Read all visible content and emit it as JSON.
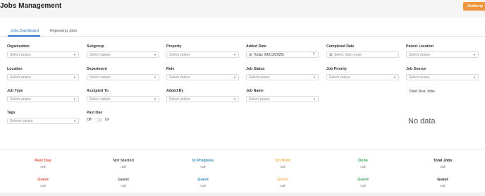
{
  "app": {
    "title": "Jobs Management",
    "user": "Anthony"
  },
  "tabs": [
    {
      "label": "Jobs Dashboard",
      "active": true
    },
    {
      "label": "Repeating Jobs",
      "active": false
    }
  ],
  "filters": {
    "organization": {
      "label": "Organization",
      "placeholder": "Select values"
    },
    "subgroup": {
      "label": "Subgroup",
      "placeholder": "Select values"
    },
    "property": {
      "label": "Property",
      "placeholder": "Select values"
    },
    "added_date": {
      "label": "Added Date",
      "value": "Today (06/13/2025)"
    },
    "completed_date": {
      "label": "Completed Date",
      "placeholder": "Select date range"
    },
    "parent_location": {
      "label": "Parent Location",
      "placeholder": "Select values"
    },
    "location": {
      "label": "Location",
      "placeholder": "Select values"
    },
    "department": {
      "label": "Department",
      "placeholder": "Select values"
    },
    "role": {
      "label": "Role",
      "placeholder": "Select values"
    },
    "job_status": {
      "label": "Job Status",
      "placeholder": "Select values"
    },
    "job_priority": {
      "label": "Job Priority",
      "placeholder": "Select values"
    },
    "job_source": {
      "label": "Job Source",
      "placeholder": "Select values"
    },
    "job_type": {
      "label": "Job Type",
      "placeholder": "Select values"
    },
    "assigned_to": {
      "label": "Assigned To",
      "placeholder": "Select values"
    },
    "added_by": {
      "label": "Added By",
      "placeholder": "Select values"
    },
    "job_name": {
      "label": "Job Name",
      "placeholder": "Select values"
    },
    "tags": {
      "label": "Tags",
      "placeholder": "Selecte values"
    },
    "past_due": {
      "label": "Past Due",
      "off": "Off",
      "on": "On",
      "enabled": false
    }
  },
  "side_panel": {
    "title": "Past Due Jobs",
    "empty_text": "No data"
  },
  "stats_row1": [
    {
      "label": "Past Due",
      "value": "null",
      "color": "#e0513a"
    },
    {
      "label": "Not Started",
      "value": "null",
      "color": "#555555"
    },
    {
      "label": "In Progress",
      "value": "null",
      "color": "#2f86b8"
    },
    {
      "label": "On Hold",
      "value": "null",
      "color": "#f0b24a"
    },
    {
      "label": "Done",
      "value": "null",
      "color": "#3aa25a"
    },
    {
      "label": "Total Jobs",
      "value": "null",
      "color": "#222222"
    }
  ],
  "stats_row2": [
    {
      "label": "Guest",
      "value": "null",
      "color": "#e0513a"
    },
    {
      "label": "Guest",
      "value": "null",
      "color": "#555555"
    },
    {
      "label": "Guest",
      "value": "null",
      "color": "#2f86b8"
    },
    {
      "label": "Guest",
      "value": "null",
      "color": "#f0b24a"
    },
    {
      "label": "Guest",
      "value": "null",
      "color": "#3aa25a"
    },
    {
      "label": "Guest",
      "value": "null",
      "color": "#222222"
    }
  ]
}
